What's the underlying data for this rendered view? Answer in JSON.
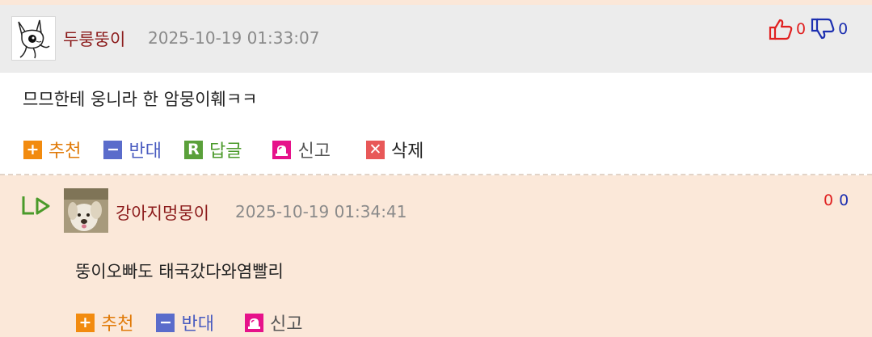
{
  "comment": {
    "nickname": "두룽뚱이",
    "datetime": "2025-10-19 01:33:07",
    "up_count": "0",
    "down_count": "0",
    "text": "므므한테 웅니라 한 암뭉이훼ㅋㅋ",
    "actions": {
      "recommend": "추천",
      "oppose": "반대",
      "reply": "답글",
      "report": "신고",
      "delete": "삭제"
    }
  },
  "reply": {
    "nickname": "강아지멍뭉이",
    "datetime": "2025-10-19 01:34:41",
    "up_count": "0",
    "down_count": "0",
    "text": "뚱이오빠도 태국갔다와염빨리",
    "actions": {
      "recommend": "추천",
      "oppose": "반대",
      "report": "신고"
    }
  },
  "icons": {
    "thumbs_up": "thumbs-up-icon",
    "thumbs_down": "thumbs-down-icon",
    "reply_arrow": "reply-arrow-icon",
    "plus": "plus-icon",
    "minus": "minus-icon",
    "reply_r": "reply-icon",
    "report": "siren-icon",
    "delete": "close-icon"
  },
  "colors": {
    "nickname": "#8b1a1a",
    "date": "#8a8a8a",
    "up": "#e02020",
    "down": "#1c2fb0",
    "comment_header_bg": "#ececec",
    "reply_bg": "#fbe8d9"
  }
}
